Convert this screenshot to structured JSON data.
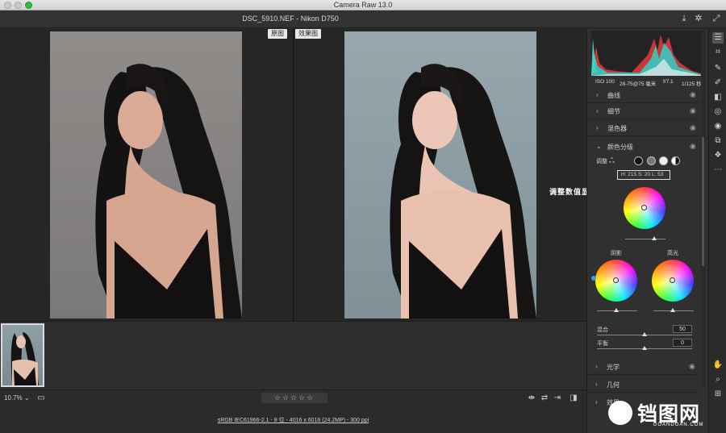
{
  "window": {
    "title": "Camera Raw 13.0"
  },
  "header": {
    "file_title": "DSC_5910.NEF  -  Nikon D750"
  },
  "canvas": {
    "before_label": "原图",
    "after_label": "效果图"
  },
  "annotation": "调整数值显示在这里",
  "exif": {
    "iso": "ISO 100",
    "lens": "28-75@75 毫米",
    "aperture": "f/7.1",
    "shutter": "1/125 秒"
  },
  "panel": {
    "sections_top": [
      {
        "label": "曲线"
      },
      {
        "label": "细节"
      },
      {
        "label": "混色器"
      }
    ],
    "color_grading": {
      "label": "颜色分级",
      "adjust_label": "调整",
      "value_h": "215",
      "value_s": "20",
      "value_l": "53",
      "value_display": "H: 215  S: 20  L: 53",
      "shadows_label": "阴影",
      "highlights_label": "高光",
      "blending_label": "混合",
      "blending_value": "50",
      "balance_label": "平衡",
      "balance_value": "0"
    },
    "sections_bottom": [
      {
        "label": "光学"
      },
      {
        "label": "几何"
      },
      {
        "label": "效果"
      }
    ]
  },
  "bottom": {
    "zoom": "10.7%",
    "stars": "☆☆☆☆☆",
    "status": "sRGB IEC61966-2.1 - 8 位 - 4016 x 6016 (24.2MP) - 300 ppi"
  },
  "watermark": {
    "text": "铛图网",
    "sub": "DOANDOAN.COM"
  },
  "icons": {
    "save": "save-icon",
    "settings": "gear-icon",
    "fullscreen": "expand-icon"
  }
}
